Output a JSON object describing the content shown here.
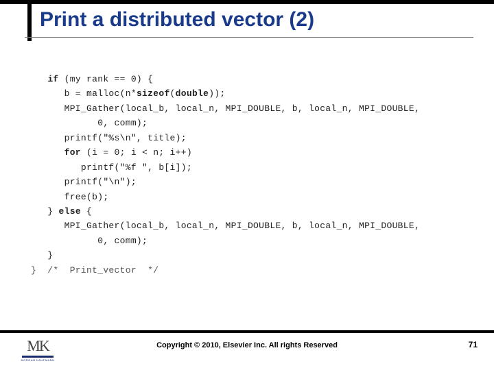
{
  "slide": {
    "title": "Print a distributed vector (2)",
    "copyright": "Copyright © 2010, Elsevier Inc. All rights Reserved",
    "page_number": "71",
    "logo": {
      "initials": "MK",
      "subtext": "MORGAN KAUFMANN"
    }
  },
  "code": {
    "lines": [
      {
        "indent": 1,
        "segments": [
          {
            "t": "if",
            "b": true
          },
          {
            "t": " (my rank == 0) {"
          }
        ]
      },
      {
        "indent": 2,
        "segments": [
          {
            "t": "b = malloc(n*"
          },
          {
            "t": "sizeof",
            "b": true
          },
          {
            "t": "("
          },
          {
            "t": "double",
            "b": true
          },
          {
            "t": "));"
          }
        ]
      },
      {
        "indent": 2,
        "segments": [
          {
            "t": "MPI_Gather(local_b, local_n, MPI_DOUBLE, b, local_n, MPI_DOUBLE,"
          }
        ]
      },
      {
        "indent": 4,
        "segments": [
          {
            "t": "0, comm);"
          }
        ]
      },
      {
        "indent": 2,
        "segments": [
          {
            "t": "printf(\"%s\\n\", title);"
          }
        ]
      },
      {
        "indent": 2,
        "segments": [
          {
            "t": "for",
            "b": true
          },
          {
            "t": " (i = 0; i < n; i++)"
          }
        ]
      },
      {
        "indent": 3,
        "segments": [
          {
            "t": "printf(\"%f \", b[i]);"
          }
        ]
      },
      {
        "indent": 2,
        "segments": [
          {
            "t": "printf(\"\\n\");"
          }
        ]
      },
      {
        "indent": 2,
        "segments": [
          {
            "t": "free(b);"
          }
        ]
      },
      {
        "indent": 1,
        "segments": [
          {
            "t": "} "
          },
          {
            "t": "else",
            "b": true
          },
          {
            "t": " {"
          }
        ]
      },
      {
        "indent": 2,
        "segments": [
          {
            "t": "MPI_Gather(local_b, local_n, MPI_DOUBLE, b, local_n, MPI_DOUBLE,"
          }
        ]
      },
      {
        "indent": 4,
        "segments": [
          {
            "t": "0, comm);"
          }
        ]
      },
      {
        "indent": 1,
        "segments": [
          {
            "t": "}"
          }
        ]
      },
      {
        "indent": 0,
        "segments": [
          {
            "t": "}  /*  Print_vector  */",
            "cls": "faded"
          }
        ]
      }
    ]
  }
}
